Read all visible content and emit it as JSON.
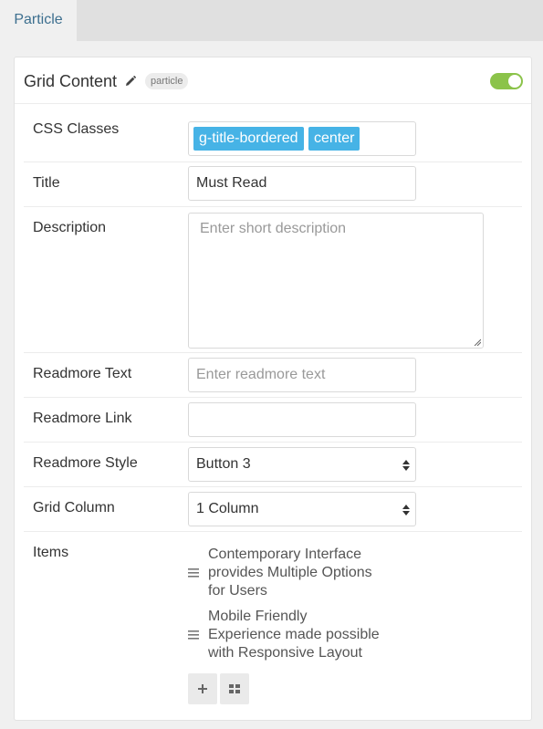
{
  "tab": {
    "label": "Particle"
  },
  "panel": {
    "title": "Grid Content",
    "badge": "particle",
    "enabled": true,
    "accent_color": "#8bc34a"
  },
  "fields": {
    "css_classes": {
      "label": "CSS Classes",
      "tags": [
        "g-title-bordered",
        "center"
      ],
      "tag_color": "#46b3e6"
    },
    "title": {
      "label": "Title",
      "value": "Must Read"
    },
    "description": {
      "label": "Description",
      "placeholder": "Enter short description"
    },
    "readmore_text": {
      "label": "Readmore Text",
      "placeholder": "Enter readmore text"
    },
    "readmore_link": {
      "label": "Readmore Link",
      "value": ""
    },
    "readmore_style": {
      "label": "Readmore Style",
      "value": "Button 3"
    },
    "grid_column": {
      "label": "Grid Column",
      "value": "1 Column"
    },
    "items": {
      "label": "Items",
      "list": [
        {
          "line1": "Contemporary Interface",
          "line2": "provides Multiple Options",
          "line3": "for Users"
        },
        {
          "line1": "Mobile Friendly",
          "line2": "Experience made possible",
          "line3": "with Responsive Layout"
        }
      ],
      "add_icon": "plus-icon",
      "grid_icon": "grid-icon"
    }
  }
}
